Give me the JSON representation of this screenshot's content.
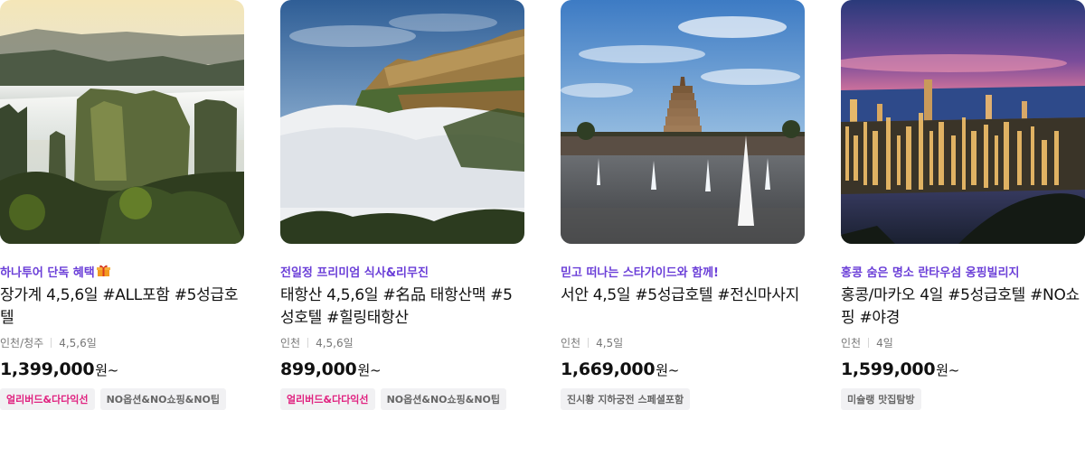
{
  "colors": {
    "promo": "#6b3fd8",
    "tag_pink": "#e0217f",
    "tag_bg": "#f1f1f3"
  },
  "products": [
    {
      "image": "zhangjiajie-mountains-photo",
      "promo": "하나투어 단독 혜택",
      "promo_icon": "gift-icon",
      "title": "장가계 4,5,6일 #ALL포함 #5성급호텔",
      "origin": "인천/청주",
      "duration": "4,5,6일",
      "price": "1,399,000",
      "currency": "원~",
      "tags": [
        {
          "label": "얼리버드&다다익선",
          "style": "pink"
        },
        {
          "label": "NO옵션&NO쇼핑&NO팁",
          "style": "gray"
        }
      ]
    },
    {
      "image": "taihang-cliffs-clouds-photo",
      "promo": "전일정 프리미엄 식사&리무진",
      "title": "태항산 4,5,6일 #名品 태항산맥 #5성호텔 #힐링태항산",
      "origin": "인천",
      "duration": "4,5,6일",
      "price": "899,000",
      "currency": "원~",
      "tags": [
        {
          "label": "얼리버드&다다익선",
          "style": "pink"
        },
        {
          "label": "NO옵션&NO쇼핑&NO팁",
          "style": "gray"
        }
      ]
    },
    {
      "image": "xian-pagoda-fountain-photo",
      "promo": "믿고 떠나는 스타가이드와 함께!",
      "title": "서안 4,5일 #5성급호텔 #전신마사지",
      "origin": "인천",
      "duration": "4,5일",
      "price": "1,669,000",
      "currency": "원~",
      "tags": [
        {
          "label": "진시황 지하궁전 스페셜포함",
          "style": "gray"
        }
      ]
    },
    {
      "image": "hongkong-night-skyline-photo",
      "promo": "홍콩 숨은 명소 란타우섬 옹핑빌리지",
      "title": "홍콩/마카오 4일 #5성급호텔 #NO쇼핑 #야경",
      "origin": "인천",
      "duration": "4일",
      "price": "1,599,000",
      "currency": "원~",
      "tags": [
        {
          "label": "미슐랭 맛집탐방",
          "style": "gray"
        }
      ]
    }
  ]
}
